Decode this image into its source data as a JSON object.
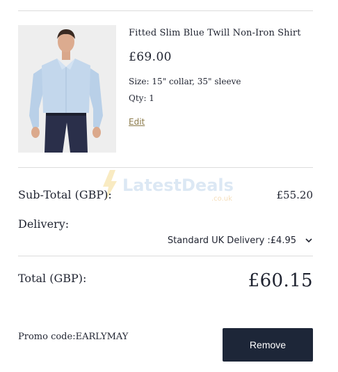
{
  "product": {
    "title": "Fitted Slim Blue Twill Non-Iron Shirt",
    "price": "£69.00",
    "size": "Size: 15\" collar, 35\" sleeve",
    "qty": "Qty: 1",
    "edit_label": "Edit",
    "image_alt": "Model wearing blue twill shirt"
  },
  "watermark": {
    "brand": "LatestDeals",
    "domain": ".co.uk"
  },
  "summary": {
    "subtotal_label": "Sub-Total (GBP):",
    "subtotal_value": "£55.20",
    "delivery_label": "Delivery:",
    "delivery_option": "Standard UK Delivery :£4.95",
    "total_label": "Total (GBP):",
    "total_value": "£60.15"
  },
  "promo": {
    "text": "Promo code:EARLYMAY",
    "remove_label": "Remove"
  },
  "colors": {
    "button_bg": "#1d2638",
    "edit_link": "#8b7a4a",
    "divider": "#dcdcdc"
  }
}
